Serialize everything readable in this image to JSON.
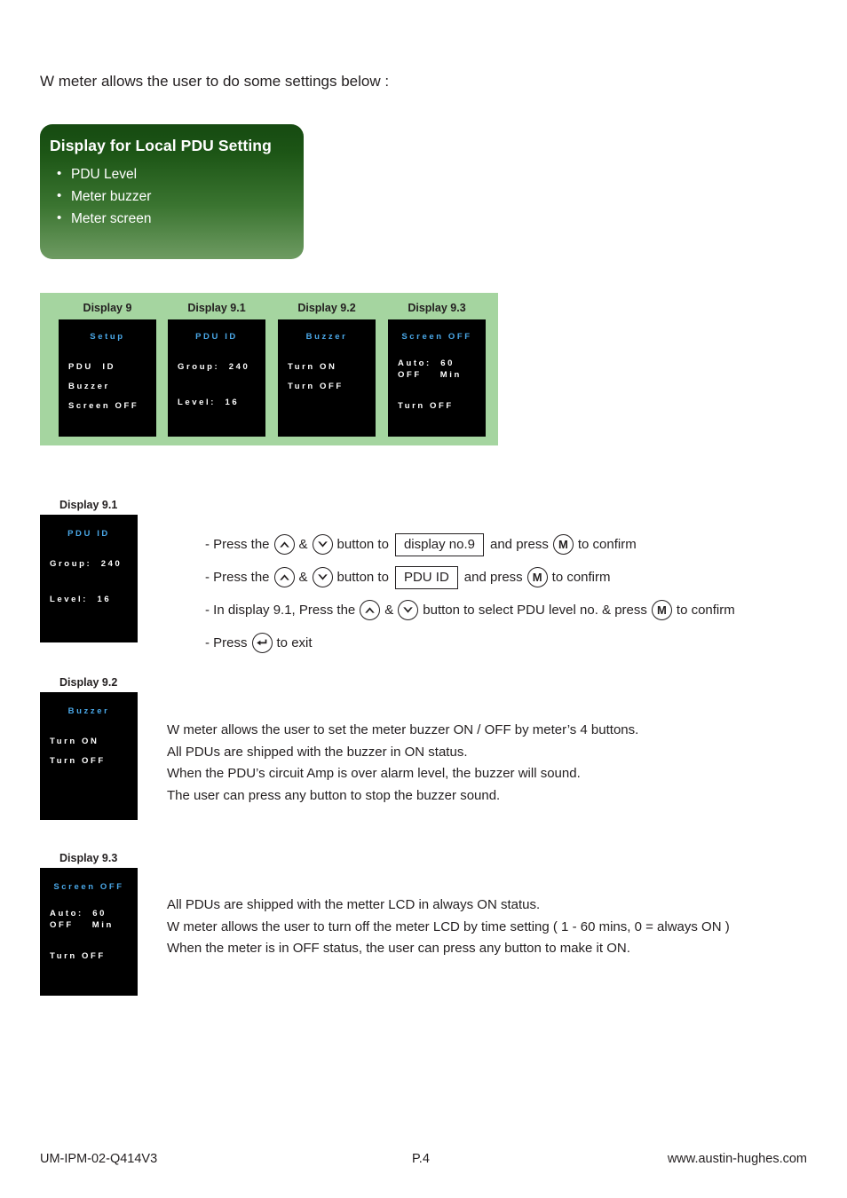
{
  "intro": "W meter allows the user to do some settings below :",
  "callout": {
    "title": "Display for Local PDU Setting",
    "items": [
      "PDU Level",
      "Meter buzzer",
      "Meter screen"
    ],
    "gradient_top": "#164a11",
    "gradient_bottom": "#6e9b62"
  },
  "strip": {
    "background": "#a5d5a0",
    "columns": [
      {
        "label": "Display 9",
        "screen": {
          "title": "Setup",
          "lines": [
            "PDU  ID",
            "Buzzer",
            "Screen OFF"
          ]
        }
      },
      {
        "label": "Display 9.1",
        "screen": {
          "title": "PDU  ID",
          "lines": [
            "Group:  240",
            "Level:  16"
          ]
        }
      },
      {
        "label": "Display 9.2",
        "screen": {
          "title": "Buzzer",
          "lines": [
            "Turn ON",
            "Turn OFF"
          ]
        }
      },
      {
        "label": "Display 9.3",
        "screen": {
          "title": "Screen OFF",
          "lines": [
            "Auto:  60",
            "OFF    Min",
            "Turn OFF"
          ]
        }
      }
    ]
  },
  "lcd_colors": {
    "background": "#000000",
    "title": "#4aa8e8",
    "text": "#ffffff"
  },
  "section_91": {
    "label": "Display 9.1",
    "screen": {
      "title": "PDU  ID",
      "lines": [
        "Group:  240",
        "Level:  16"
      ]
    },
    "instructions": [
      {
        "prefix": "- Press the",
        "between": "&",
        "mid": "button to",
        "boxed": "display no.9",
        "after_box": "and press",
        "suffix": "to confirm"
      },
      {
        "prefix": "- Press the",
        "between": "&",
        "mid": "button to",
        "boxed": "PDU  ID",
        "after_box": "and press",
        "suffix": "to confirm"
      },
      {
        "prefix": "- In display 9.1, Press the",
        "between": "&",
        "mid": "button to select PDU level no. & press",
        "suffix": "to confirm"
      },
      {
        "prefix": "- Press",
        "suffix": "to exit"
      }
    ],
    "icons": {
      "up": "chevron-up-icon",
      "down": "chevron-down-icon",
      "confirm": "M",
      "exit": "back-arrow-icon"
    }
  },
  "section_92": {
    "label": "Display 9.2",
    "screen": {
      "title": "Buzzer",
      "lines": [
        "Turn ON",
        "Turn OFF"
      ]
    },
    "paragraph": [
      "W meter allows the user to set the meter buzzer ON / OFF by meter’s 4 buttons.",
      "All PDUs are shipped with the buzzer in ON status.",
      "When the PDU’s circuit Amp is over alarm level, the buzzer will sound.",
      "The user can press any button to stop the buzzer sound."
    ]
  },
  "section_93": {
    "label": "Display 9.3",
    "screen": {
      "title": "Screen OFF",
      "lines": [
        "Auto:  60",
        "OFF    Min",
        "Turn OFF"
      ]
    },
    "paragraph": [
      "All PDUs are shipped with the metter LCD in always ON status.",
      "W meter allows the user to turn off the meter LCD by time setting ( 1 - 60 mins, 0 = always ON )",
      "When the meter is in OFF status, the user can press any button to make it ON."
    ]
  },
  "footer": {
    "left": "UM-IPM-02-Q414V3",
    "middle": "P.4",
    "right": "www.austin-hughes.com"
  }
}
